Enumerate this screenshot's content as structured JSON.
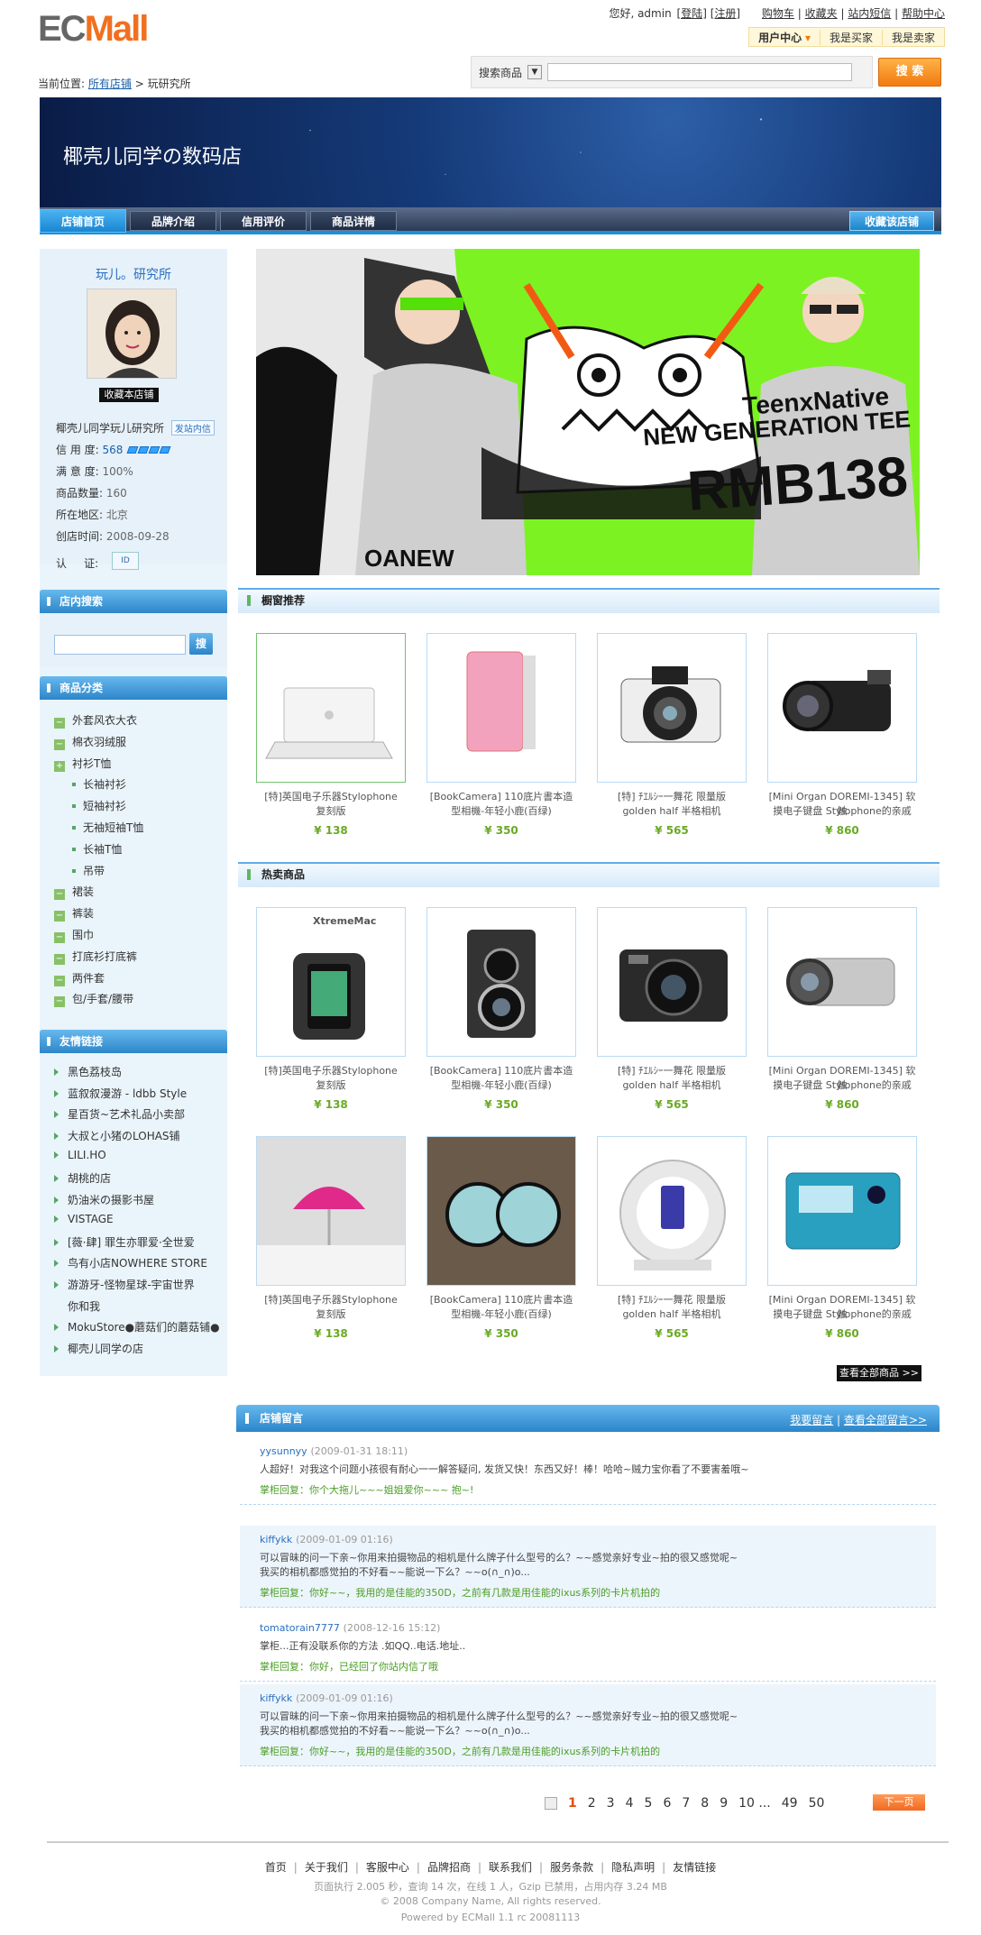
{
  "header": {
    "logo_e": "EC",
    "logo_m": "Mall",
    "greeting": "您好, admin",
    "logout": "[登陆]",
    "register": "[注册]",
    "links": [
      "购物车",
      "收藏夹",
      "站内短信",
      "帮助中心"
    ],
    "user_bar": [
      "用户中心",
      "我是买家",
      "我是卖家"
    ]
  },
  "breadcrumb": {
    "label": "当前位置:",
    "items": [
      "所有店铺",
      "玩研究所"
    ],
    "sep": ">"
  },
  "search": {
    "scope": "搜索商品",
    "placeholder": "",
    "button": "搜 索"
  },
  "banner": {
    "store_title": "椰壳儿同学の数码店"
  },
  "nav": {
    "tabs": [
      "店铺首页",
      "品牌介绍",
      "信用评价",
      "商品详情"
    ],
    "favorite": "收藏该店铺"
  },
  "store": {
    "name": "玩儿。研究所",
    "favorite_btn": "收藏本店铺",
    "owner": "椰壳儿同学玩儿研究所",
    "message_btn": "发站内信",
    "credit_label": "信 用 度:",
    "credit_value": "568",
    "satisfaction_label": "满 意 度:",
    "satisfaction_value": "100%",
    "goods_label": "商品数量:",
    "goods_value": "160",
    "region_label": "所在地区:",
    "region_value": "北京",
    "created_label": "创店时间:",
    "created_value": "2008-09-28",
    "cert_label": "认     证:"
  },
  "store_search": {
    "title": "店内搜索",
    "button": "搜"
  },
  "categories": {
    "title": "商品分类",
    "items": [
      {
        "label": "外套风衣大衣",
        "level": 1
      },
      {
        "label": "棉衣羽绒服",
        "level": 1
      },
      {
        "label": "衬衫T恤",
        "level": 1
      },
      {
        "label": "长袖衬衫",
        "level": 2
      },
      {
        "label": "短袖衬衫",
        "level": 2
      },
      {
        "label": "无袖短袖T恤",
        "level": 2
      },
      {
        "label": "长袖T恤",
        "level": 2
      },
      {
        "label": "吊带",
        "level": 2
      },
      {
        "label": "裙装",
        "level": 1
      },
      {
        "label": "裤装",
        "level": 1
      },
      {
        "label": "围巾",
        "level": 1
      },
      {
        "label": "打底衫打底裤",
        "level": 1
      },
      {
        "label": "两件套",
        "level": 1
      },
      {
        "label": "包/手套/腰带",
        "level": 1
      }
    ]
  },
  "links": {
    "title": "友情链接",
    "items": [
      "黑色荔枝岛",
      "蓝叙叙漫游 - ldbb Style",
      "星百货~艺术礼品小卖部",
      "大叔と小猪のLOHAS铺",
      "LILI.HO",
      "胡桃的店",
      "奶油米の摄影书屋",
      "VISTAGE",
      "[薇·肆] 罪生亦罪爱·全世爱",
      "鸟有小店NOWHERE STORE",
      "游游牙-怪物星球-宇宙世界",
      "你和我",
      "MokuStore●蘑菇们的蘑菇铺●",
      "椰壳儿同学の店"
    ]
  },
  "hero": {
    "line1": "TeenxNative",
    "line2": "NEW GENERATION TEE",
    "line3": "RMB138",
    "side": "OANEW"
  },
  "recommended": {
    "title": "橱窗推荐",
    "products": [
      {
        "name1": "[特]英国电子乐器Stylophone",
        "name2": "复刻版",
        "price": "¥ 138",
        "icon": "laptop-white"
      },
      {
        "name1": "[BookCamera] 110底片書本造",
        "name2": "型相機-年轻小鹿(百绿)",
        "price": "¥ 350",
        "icon": "laptop-pink"
      },
      {
        "name1": "[特] ﾁｴﾙｼｰ一舞花 限量版",
        "name2": "golden half 半格相机",
        "price": "¥ 565",
        "icon": "camera-pentax"
      },
      {
        "name1": "[Mini Organ DOREMI-1345] 软触",
        "name2": "摸电子键盘 Stylophone的亲戚",
        "price": "¥ 860",
        "icon": "camcorder-black"
      }
    ]
  },
  "hot": {
    "title": "热卖商品",
    "products": [
      {
        "name1": "[特]英国电子乐器Stylophone",
        "name2": "复刻版",
        "price": "¥ 138",
        "brand": "XtremeMac",
        "icon": "armband"
      },
      {
        "name1": "[BookCamera] 110底片書本造",
        "name2": "型相機-年轻小鹿(百绿)",
        "price": "¥ 350",
        "icon": "rolleiflex"
      },
      {
        "name1": "[特] ﾁｴﾙｼｰ一舞花 限量版",
        "name2": "golden half 半格相机",
        "price": "¥ 565",
        "icon": "canon-g10"
      },
      {
        "name1": "[Mini Organ DOREMI-1345] 软触",
        "name2": "摸电子键盘 Stylophone的亲戚",
        "price": "¥ 860",
        "icon": "camcorder-silver"
      },
      {
        "name1": "[特]英国电子乐器Stylophone",
        "name2": "复刻版",
        "price": "¥ 138",
        "icon": "umbrella-pin"
      },
      {
        "name1": "[BookCamera] 110底片書本造",
        "name2": "型相機-年轻小鹿(百绿)",
        "price": "¥ 350",
        "icon": "speakers"
      },
      {
        "name1": "[特] ﾁｴﾙｼｰ一舞花 限量版",
        "name2": "golden half 半格相机",
        "price": "¥ 565",
        "icon": "ipod-dock"
      },
      {
        "name1": "[Mini Organ DOREMI-1345] 软触",
        "name2": "摸电子键盘 Stylophone的亲戚",
        "price": "¥ 860",
        "icon": "sony-camera"
      }
    ],
    "view_all": "查看全部商品 >>"
  },
  "guestbook": {
    "title": "店铺留言",
    "post": "我要留言",
    "view_all": "查看全部留言>>",
    "messages": [
      {
        "author": "yysunnyy",
        "time": "(2009-01-31 18:11)",
        "content": "人超好！对我这个问题小孩很有耐心一一解答疑问, 发货又快！东西又好！棒！哈哈~贼力宝你看了不要害羞哦~",
        "reply": "掌柜回复：你个大拖儿~~~姐姐爱你~~~ 抱~!"
      },
      {
        "author": "kiffykk",
        "time": "(2009-01-09 01:16)",
        "content": "可以冒昧的问一下亲~你用来拍摄物品的相机是什么牌子什么型号的么？~~感觉亲好专业~拍的很又感觉呢~\n我买的相机都感觉拍的不好看~~能说一下么？~~o(∩_∩)o...",
        "reply": "掌柜回复：你好~~，我用的是佳能的350D，之前有几款是用佳能的ixus系列的卡片机拍的"
      },
      {
        "author": "tomatorain7777",
        "time": "(2008-12-16 15:12)",
        "content": "掌柜...正有没联系你的方法 .如QQ..电话.地址..",
        "reply": "掌柜回复：你好，已经回了你站内信了哦"
      },
      {
        "author": "kiffykk",
        "time": "(2009-01-09 01:16)",
        "content": "可以冒昧的问一下亲~你用来拍摄物品的相机是什么牌子什么型号的么？~~感觉亲好专业~拍的很又感觉呢~\n我买的相机都感觉拍的不好看~~能说一下么？~~o(∩_∩)o...",
        "reply": "掌柜回复：你好~~，我用的是佳能的350D，之前有几款是用佳能的ixus系列的卡片机拍的"
      }
    ]
  },
  "pagination": {
    "pages": [
      "1",
      "2",
      "3",
      "4",
      "5",
      "6",
      "7",
      "8",
      "9",
      "10 ...",
      "49",
      "50"
    ],
    "current": "1",
    "next": "下一页"
  },
  "footer": {
    "links": [
      "首页",
      "关于我们",
      "客服中心",
      "品牌招商",
      "联系我们",
      "服务条款",
      "隐私声明",
      "友情链接"
    ],
    "stats": "页面执行 2.005 秒，查询 14 次，在线 1 人，Gzip 已禁用，占用内存 3.24 MB",
    "copyright": "© 2008 Company Name, All rights reserved.",
    "powered": "Powered by ECMall 1.1 rc 20081113"
  }
}
